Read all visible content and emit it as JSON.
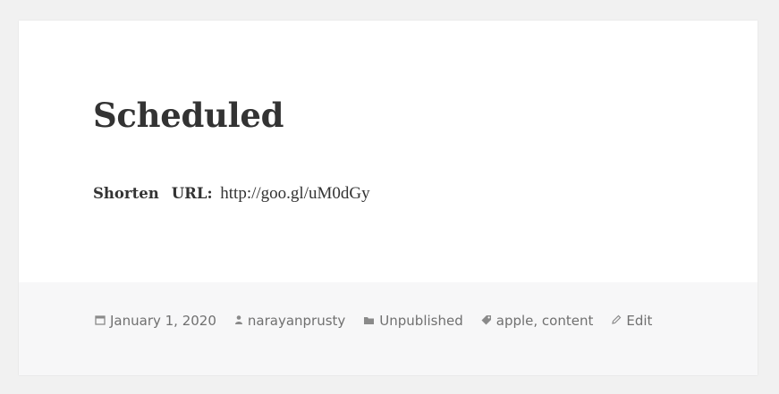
{
  "post": {
    "title": "Scheduled",
    "body": {
      "shorten_label": "Shorten",
      "url_label": "URL:",
      "url_value": "http://goo.gl/uM0dGy"
    }
  },
  "footer": {
    "date": "January 1, 2020",
    "author": "narayanprusty",
    "category": "Unpublished",
    "tags": "apple, content",
    "edit_label": "Edit"
  },
  "icons": {
    "date": "calendar-icon",
    "author": "user-icon",
    "category": "folder-icon",
    "tags": "tag-icon",
    "edit": "pencil-icon"
  },
  "colors": {
    "page_background": "#f1f1f1",
    "card_background": "#ffffff",
    "footer_background": "#f7f7f8",
    "title_text": "#333333",
    "meta_text": "#707070"
  }
}
